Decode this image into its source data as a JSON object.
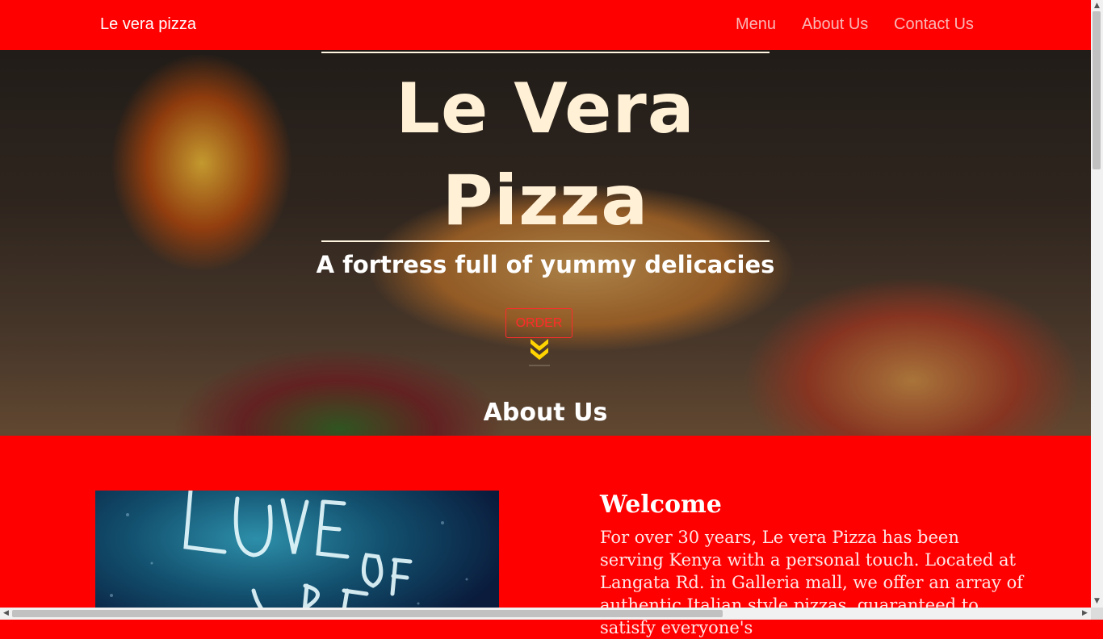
{
  "navbar": {
    "brand": "Le vera pizza",
    "links": [
      {
        "label": "Menu"
      },
      {
        "label": "About Us"
      },
      {
        "label": "Contact Us"
      }
    ],
    "background_color": "#ff0000"
  },
  "hero": {
    "title_line1": "Le Vera",
    "title_line2": "Pizza",
    "tagline": "A fortress full of yummy delicacies",
    "order_button": "ORDER",
    "scroll_icon": "double-chevron-down-icon",
    "section_heading": "About Us",
    "background_image": "pizzas-by-wood-fired-oven-photo"
  },
  "about": {
    "image": "neon-love-sign-photo",
    "title": "Welcome",
    "text": "For over 30 years, Le vera Pizza has been serving Kenya with a personal touch. Located at Langata Rd. in Galleria mall, we offer an array of authentic Italian style pizzas, guaranteed to satisfy everyone's"
  },
  "colors": {
    "accent": "#ff0000",
    "title_cream": "#fff0d6",
    "chevron_yellow": "#ffd400"
  }
}
